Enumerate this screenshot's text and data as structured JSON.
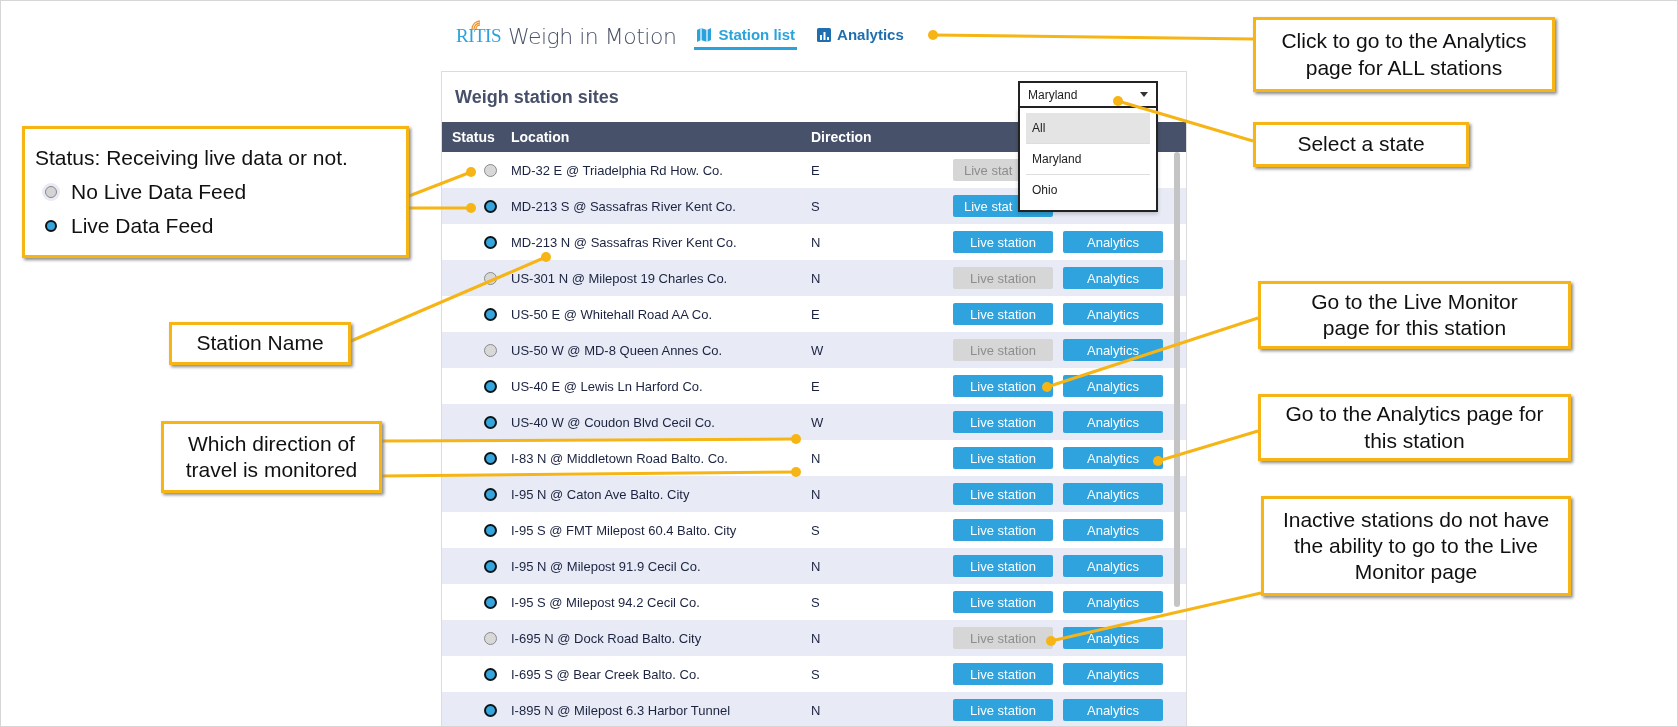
{
  "header": {
    "logo": "RITIS",
    "app_title": "Weigh in Motion",
    "tabs": [
      {
        "label": "Station list",
        "kind": "map",
        "selected": true
      },
      {
        "label": "Analytics",
        "kind": "chart",
        "selected": false
      }
    ]
  },
  "panel": {
    "title": "Weigh station sites",
    "state_select": {
      "value": "Maryland",
      "expanded": true,
      "options": [
        {
          "label": "All",
          "highlighted": true
        },
        {
          "label": "Maryland",
          "highlighted": false
        },
        {
          "label": "Ohio",
          "highlighted": false
        }
      ]
    }
  },
  "table": {
    "columns": [
      "Status",
      "Location",
      "Direction"
    ],
    "rows": [
      {
        "live": false,
        "location": "MD-32 E @ Triadelphia Rd How. Co.",
        "direction": "E",
        "live_button": {
          "label": "Live stat",
          "disabled": true
        }
      },
      {
        "live": true,
        "location": "MD-213 S @ Sassafras River Kent Co.",
        "direction": "S",
        "live_button": {
          "label": "Live stat",
          "disabled": false
        }
      },
      {
        "live": true,
        "location": "MD-213 N @ Sassafras River Kent Co.",
        "direction": "N",
        "live_button": {
          "label": "Live station",
          "disabled": false
        },
        "analytics_button": "Analytics"
      },
      {
        "live": false,
        "location": "US-301 N @ Milepost 19 Charles Co.",
        "direction": "N",
        "live_button": {
          "label": "Live station",
          "disabled": true
        },
        "analytics_button": "Analytics"
      },
      {
        "live": true,
        "location": "US-50 E @ Whitehall Road AA Co.",
        "direction": "E",
        "live_button": {
          "label": "Live station",
          "disabled": false
        },
        "analytics_button": "Analytics"
      },
      {
        "live": false,
        "location": "US-50 W @ MD-8 Queen Annes Co.",
        "direction": "W",
        "live_button": {
          "label": "Live station",
          "disabled": true
        },
        "analytics_button": "Analytics"
      },
      {
        "live": true,
        "location": "US-40 E @ Lewis Ln Harford Co.",
        "direction": "E",
        "live_button": {
          "label": "Live station",
          "disabled": false
        },
        "analytics_button": "Analytics"
      },
      {
        "live": true,
        "location": "US-40 W @ Coudon Blvd Cecil Co.",
        "direction": "W",
        "live_button": {
          "label": "Live station",
          "disabled": false
        },
        "analytics_button": "Analytics"
      },
      {
        "live": true,
        "location": "I-83 N @ Middletown Road Balto. Co.",
        "direction": "N",
        "live_button": {
          "label": "Live station",
          "disabled": false
        },
        "analytics_button": "Analytics"
      },
      {
        "live": true,
        "location": "I-95 N @ Caton Ave Balto. City",
        "direction": "N",
        "live_button": {
          "label": "Live station",
          "disabled": false
        },
        "analytics_button": "Analytics"
      },
      {
        "live": true,
        "location": "I-95 S @ FMT Milepost 60.4 Balto. City",
        "direction": "S",
        "live_button": {
          "label": "Live station",
          "disabled": false
        },
        "analytics_button": "Analytics"
      },
      {
        "live": true,
        "location": "I-95 N @ Milepost 91.9 Cecil Co.",
        "direction": "N",
        "live_button": {
          "label": "Live station",
          "disabled": false
        },
        "analytics_button": "Analytics"
      },
      {
        "live": true,
        "location": "I-95 S @ Milepost 94.2 Cecil Co.",
        "direction": "S",
        "live_button": {
          "label": "Live station",
          "disabled": false
        },
        "analytics_button": "Analytics"
      },
      {
        "live": false,
        "location": "I-695 N @ Dock Road Balto. City",
        "direction": "N",
        "live_button": {
          "label": "Live station",
          "disabled": true
        },
        "analytics_button": "Analytics"
      },
      {
        "live": true,
        "location": "I-695 S @ Bear Creek Balto. Co.",
        "direction": "S",
        "live_button": {
          "label": "Live station",
          "disabled": false
        },
        "analytics_button": "Analytics"
      },
      {
        "live": true,
        "location": "I-895 N @ Milepost 6.3 Harbor Tunnel",
        "direction": "N",
        "live_button": {
          "label": "Live station",
          "disabled": false
        },
        "analytics_button": "Analytics"
      }
    ]
  },
  "callouts": [
    {
      "text": "Status: Receiving live data or not.",
      "legend": [
        {
          "live": false,
          "label": "No Live Data Feed"
        },
        {
          "live": true,
          "label": "Live Data Feed"
        }
      ]
    },
    {
      "text": "Station Name"
    },
    {
      "text": "Which direction of travel is monitored"
    },
    {
      "text": "Click to go to the Analytics page for ALL stations"
    },
    {
      "text": "Select a state"
    },
    {
      "text": "Go to the Live Monitor page for this station"
    },
    {
      "text": "Go to the Analytics page for this station"
    },
    {
      "text": "Inactive stations do not have the ability to go to the Live Monitor page"
    }
  ]
}
